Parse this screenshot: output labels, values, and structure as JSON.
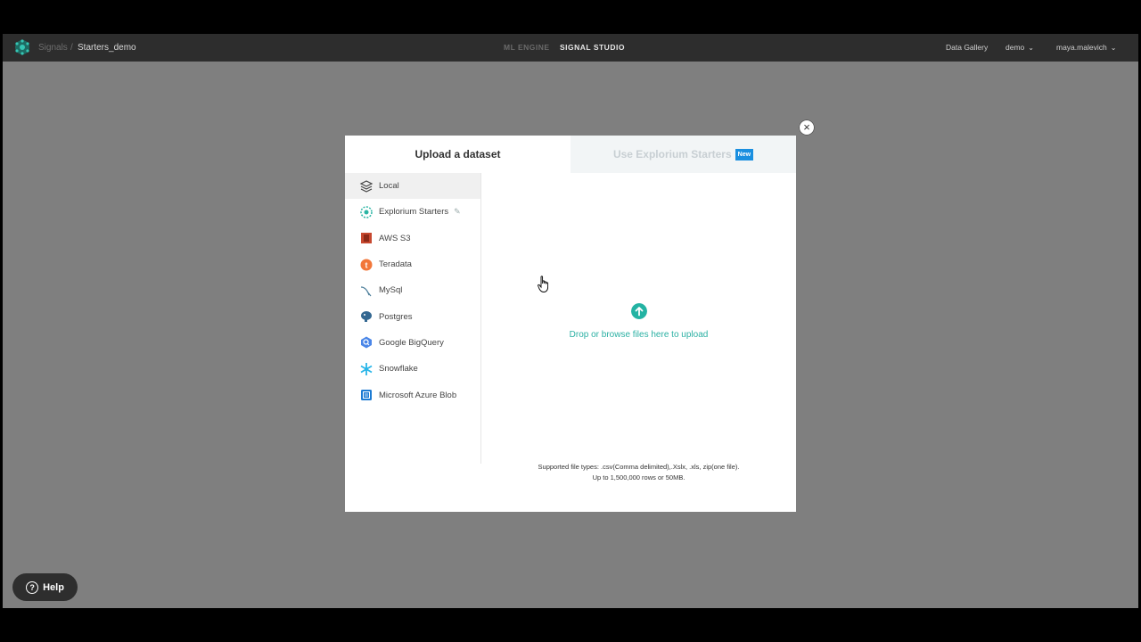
{
  "topbar": {
    "breadcrumb_root": "Signals",
    "breadcrumb_sep": "/",
    "breadcrumb_current": "Starters_demo",
    "nav_ml_engine": "ML ENGINE",
    "nav_signal_studio": "SIGNAL STUDIO",
    "data_gallery": "Data Gallery",
    "workspace": "demo",
    "user": "maya.malevich"
  },
  "modal": {
    "tab_upload": "Upload a dataset",
    "tab_starters": "Use Explorium Starters",
    "badge_new": "New",
    "close_symbol": "×",
    "sources": [
      {
        "label": "Local",
        "icon": "layers-icon"
      },
      {
        "label": "Explorium Starters",
        "icon": "explorium-icon"
      },
      {
        "label": "AWS S3",
        "icon": "aws-s3-icon"
      },
      {
        "label": "Teradata",
        "icon": "teradata-icon"
      },
      {
        "label": "MySql",
        "icon": "mysql-icon"
      },
      {
        "label": "Postgres",
        "icon": "postgres-icon"
      },
      {
        "label": "Google BigQuery",
        "icon": "bigquery-icon"
      },
      {
        "label": "Snowflake",
        "icon": "snowflake-icon"
      },
      {
        "label": "Microsoft Azure Blob",
        "icon": "azure-icon"
      }
    ],
    "upload_text": "Drop or browse files here to upload",
    "supported_types": "Supported file types: .csv(Comma delimited),.Xslx, .xls, zip(one file).",
    "limits": "Up to 1,500,000 rows or 50MB."
  },
  "help_label": "Help",
  "colors": {
    "accent": "#23b3a3",
    "badge": "#1a8fe0",
    "topbar": "#2d2d2d",
    "overlay": "#7f7f7f"
  }
}
